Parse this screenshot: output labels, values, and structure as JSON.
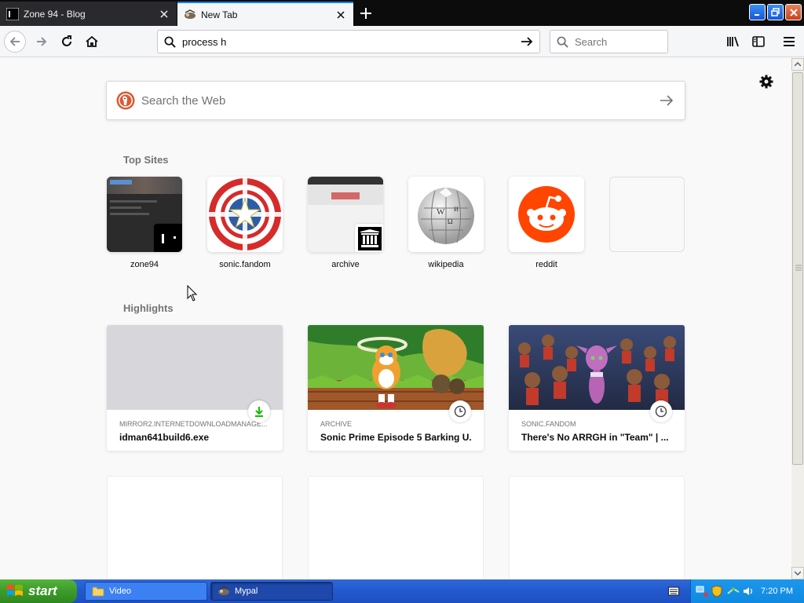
{
  "tabs": [
    {
      "title": "Zone 94 - Blog",
      "active": false
    },
    {
      "title": "New Tab",
      "active": true
    }
  ],
  "toolbar": {
    "url": "process h",
    "search_placeholder": "Search"
  },
  "newtab": {
    "websearch_placeholder": "Search the Web",
    "top_sites_title": "Top Sites",
    "top_sites": [
      {
        "label": "zone94"
      },
      {
        "label": "sonic.fandom"
      },
      {
        "label": "archive"
      },
      {
        "label": "wikipedia"
      },
      {
        "label": "reddit"
      },
      {
        "label": ""
      }
    ],
    "highlights_title": "Highlights",
    "highlights": [
      {
        "source": "MIRROR2.INTERNETDOWNLOADMANAGE...",
        "title": "idman641build6.exe",
        "icon": "download-icon"
      },
      {
        "source": "ARCHIVE",
        "title": "Sonic Prime Episode 5 Barking U...",
        "icon": "clock-icon"
      },
      {
        "source": "SONIC.FANDOM",
        "title": "There's No ARRGH in \"Team\" | ...",
        "icon": "clock-icon"
      }
    ]
  },
  "taskbar": {
    "start_label": "start",
    "tasks": [
      {
        "label": "Video"
      },
      {
        "label": "Mypal"
      }
    ],
    "clock": "7:20 PM"
  },
  "colors": {
    "accent": "#0a84ff",
    "reddit": "#ff4500",
    "taskbar": "#245bd0",
    "start": "#3c9b29"
  }
}
